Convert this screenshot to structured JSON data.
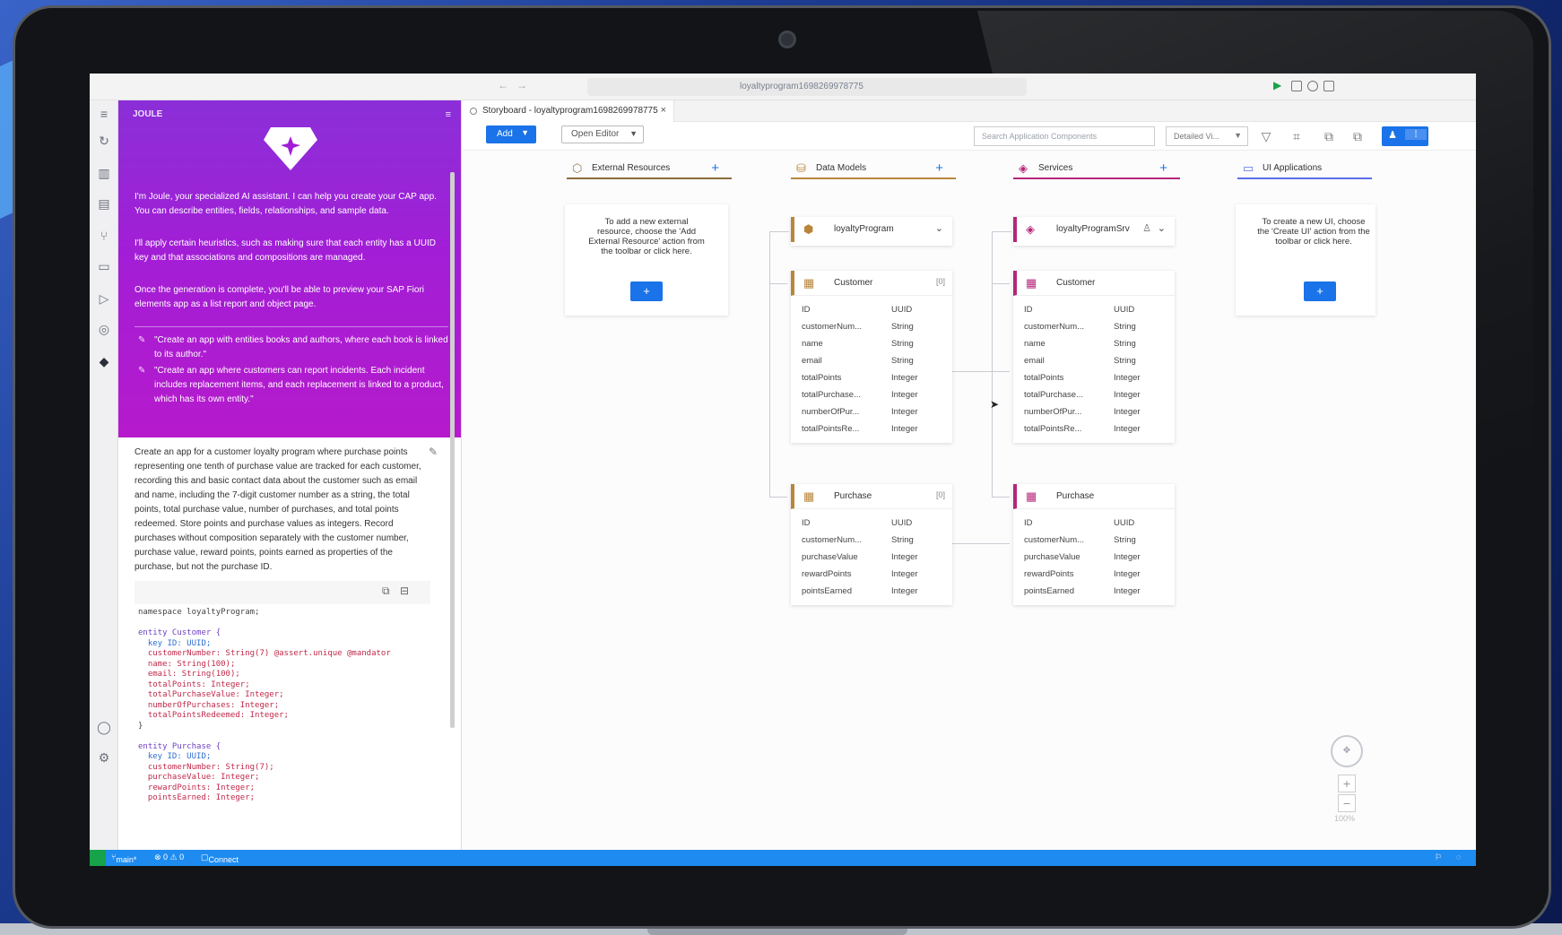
{
  "titlebar": {
    "url": "loyaltyprogram1698269978775"
  },
  "editor_tab": {
    "label": "Storyboard - loyaltyprogram1698269978775",
    "close": "×"
  },
  "toolbar": {
    "add_label": "Add",
    "open_editor_label": "Open Editor",
    "search_placeholder": "Search Application Components",
    "detail_select": "Detailed Vi..."
  },
  "joule": {
    "title": "JOULE",
    "intro": "I'm Joule, your specialized AI assistant. I can help you create your CAP app. You can describe entities, fields, relationships, and sample data.",
    "heuristics": "I'll apply certain heuristics, such as making sure that each entity has a UUID key and that associations and compositions are managed.",
    "completion": "Once the generation is complete, you'll be able to preview your SAP Fiori elements app as a list report and object page.",
    "suggestions": [
      "\"Create an app with entities books and authors, where each book is linked to its author.\"",
      "\"Create an app where customers can report incidents. Each incident includes replacement items, and each replacement is linked to a product, which has its own entity.\""
    ],
    "prompt": "Create an app for a customer loyalty program where purchase points representing one tenth of purchase value are tracked for each customer, recording this and basic contact data about the customer such as email and name, including the 7-digit customer number as a string, the total points, total purchase value, number of purchases, and total points redeemed. Store points and purchase values as integers. Record purchases without composition separately with the customer number, purchase value, reward points, points earned as properties of the purchase, but not the purchase ID.",
    "code_lines": [
      {
        "text": "namespace loyaltyProgram;",
        "cls": ""
      },
      {
        "text": "",
        "cls": ""
      },
      {
        "text": "entity Customer {",
        "cls": "kw"
      },
      {
        "text": "  key ID: UUID;",
        "cls": "ty"
      },
      {
        "text": "  customerNumber: String(7) @assert.unique @mandator",
        "cls": "pr"
      },
      {
        "text": "  name: String(100);",
        "cls": "pr"
      },
      {
        "text": "  email: String(100);",
        "cls": "pr"
      },
      {
        "text": "  totalPoints: Integer;",
        "cls": "pr"
      },
      {
        "text": "  totalPurchaseValue: Integer;",
        "cls": "pr"
      },
      {
        "text": "  numberOfPurchases: Integer;",
        "cls": "pr"
      },
      {
        "text": "  totalPointsRedeemed: Integer;",
        "cls": "pr"
      },
      {
        "text": "}",
        "cls": ""
      },
      {
        "text": "",
        "cls": ""
      },
      {
        "text": "entity Purchase {",
        "cls": "kw"
      },
      {
        "text": "  key ID: UUID;",
        "cls": "ty"
      },
      {
        "text": "  customerNumber: String(7);",
        "cls": "pr"
      },
      {
        "text": "  purchaseValue: Integer;",
        "cls": "pr"
      },
      {
        "text": "  rewardPoints: Integer;",
        "cls": "pr"
      },
      {
        "text": "  pointsEarned: Integer;",
        "cls": "pr"
      }
    ]
  },
  "statusbar": {
    "branch": "main*",
    "problems": "⊗ 0 ⚠ 0",
    "connect": "Connect"
  },
  "columns": {
    "external": {
      "title": "External Resources",
      "empty_msg": "To add a new external resource, choose the 'Add External Resource' action from the toolbar or click here."
    },
    "data_models": {
      "title": "Data Models"
    },
    "services": {
      "title": "Services"
    },
    "ui_apps": {
      "title": "UI Applications",
      "empty_msg": "To create a new UI, choose the 'Create UI' action from the toolbar or click here."
    }
  },
  "data_models": {
    "namespace": "loyaltyProgram",
    "customer": {
      "name": "Customer",
      "badge": "[0]",
      "fields": [
        {
          "n": "ID",
          "t": "UUID"
        },
        {
          "n": "customerNum...",
          "t": "String"
        },
        {
          "n": "name",
          "t": "String"
        },
        {
          "n": "email",
          "t": "String"
        },
        {
          "n": "totalPoints",
          "t": "Integer"
        },
        {
          "n": "totalPurchase...",
          "t": "Integer"
        },
        {
          "n": "numberOfPur...",
          "t": "Integer"
        },
        {
          "n": "totalPointsRe...",
          "t": "Integer"
        }
      ]
    },
    "purchase": {
      "name": "Purchase",
      "badge": "[0]",
      "fields": [
        {
          "n": "ID",
          "t": "UUID"
        },
        {
          "n": "customerNum...",
          "t": "String"
        },
        {
          "n": "purchaseValue",
          "t": "Integer"
        },
        {
          "n": "rewardPoints",
          "t": "Integer"
        },
        {
          "n": "pointsEarned",
          "t": "Integer"
        }
      ]
    }
  },
  "services": {
    "service_name": "loyaltyProgramSrv",
    "customer": {
      "name": "Customer",
      "fields": [
        {
          "n": "ID",
          "t": "UUID"
        },
        {
          "n": "customerNum...",
          "t": "String"
        },
        {
          "n": "name",
          "t": "String"
        },
        {
          "n": "email",
          "t": "String"
        },
        {
          "n": "totalPoints",
          "t": "Integer"
        },
        {
          "n": "totalPurchase...",
          "t": "Integer"
        },
        {
          "n": "numberOfPur...",
          "t": "Integer"
        },
        {
          "n": "totalPointsRe...",
          "t": "Integer"
        }
      ]
    },
    "purchase": {
      "name": "Purchase",
      "fields": [
        {
          "n": "ID",
          "t": "UUID"
        },
        {
          "n": "customerNum...",
          "t": "String"
        },
        {
          "n": "purchaseValue",
          "t": "Integer"
        },
        {
          "n": "rewardPoints",
          "t": "Integer"
        },
        {
          "n": "pointsEarned",
          "t": "Integer"
        }
      ]
    }
  },
  "zoom": {
    "level": "100%"
  },
  "colors": {
    "accent": "#1a73e8",
    "joule_gradient_top": "#8b2fd8",
    "joule_gradient_bottom": "#b61acc",
    "data_model_bar": "#b8863b",
    "service_bar": "#b5267a",
    "external_bar": "#8a6d3b",
    "ui_bar": "#5b6ee8",
    "statusbar": "#1e8bf0"
  },
  "icons": {
    "external": "cube-outline-icon",
    "data_models": "database-icon",
    "services": "service-icon",
    "ui_apps": "monitor-icon"
  }
}
